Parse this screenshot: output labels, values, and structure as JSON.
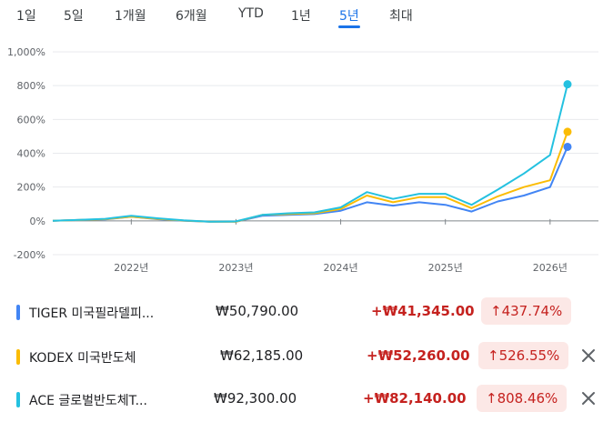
{
  "tabs": [
    "1일",
    "5일",
    "1개월",
    "6개월",
    "YTD",
    "1년",
    "5년",
    "최대"
  ],
  "active_tab": 6,
  "colors": {
    "tiger": "#4285f4",
    "kodex": "#fbbc04",
    "ace": "#24c1e0",
    "accent": "#1a73e8",
    "negative_text": "#c5221f",
    "pct_badge_bg": "#fce8e6"
  },
  "chart_data": {
    "type": "line",
    "y_ticks": [
      "1,000%",
      "800%",
      "600%",
      "400%",
      "200%",
      "0%",
      "-200%"
    ],
    "x_ticks": [
      "2022년",
      "2023년",
      "2024년",
      "2025년",
      "2026년"
    ],
    "ylim": [
      -200,
      1000
    ],
    "grid": true,
    "x": [
      "2021-04",
      "2021-07",
      "2021-10",
      "2022-01",
      "2022-04",
      "2022-07",
      "2022-10",
      "2023-01",
      "2023-04",
      "2023-07",
      "2023-10",
      "2024-01",
      "2024-04",
      "2024-07",
      "2024-10",
      "2025-01",
      "2025-04",
      "2025-07",
      "2025-10",
      "2026-01",
      "2026-03"
    ],
    "series": [
      {
        "name": "TIGER 미국필라델피...",
        "color_key": "tiger",
        "values": [
          0,
          5,
          8,
          25,
          10,
          0,
          -5,
          -5,
          30,
          35,
          40,
          60,
          110,
          90,
          110,
          95,
          55,
          115,
          150,
          200,
          438
        ]
      },
      {
        "name": "KODEX 미국반도체",
        "color_key": "kodex",
        "values": [
          0,
          5,
          10,
          25,
          12,
          2,
          -5,
          -5,
          35,
          40,
          45,
          70,
          150,
          110,
          140,
          140,
          75,
          145,
          200,
          240,
          527
        ]
      },
      {
        "name": "ACE 글로벌반도체T...",
        "color_key": "ace",
        "values": [
          0,
          6,
          12,
          30,
          15,
          3,
          -5,
          -3,
          35,
          45,
          50,
          80,
          170,
          130,
          160,
          160,
          95,
          185,
          280,
          390,
          808
        ]
      }
    ]
  },
  "rows": [
    {
      "name": "TIGER 미국필라델피...",
      "price": "₩50,790.00",
      "change": "+₩41,345.00",
      "pct": "↑437.74%",
      "color_key": "tiger",
      "removable": false
    },
    {
      "name": "KODEX 미국반도체",
      "price": "₩62,185.00",
      "change": "+₩52,260.00",
      "pct": "↑526.55%",
      "color_key": "kodex",
      "removable": true
    },
    {
      "name": "ACE 글로벌반도체T...",
      "price": "₩92,300.00",
      "change": "+₩82,140.00",
      "pct": "↑808.46%",
      "color_key": "ace",
      "removable": true
    }
  ]
}
